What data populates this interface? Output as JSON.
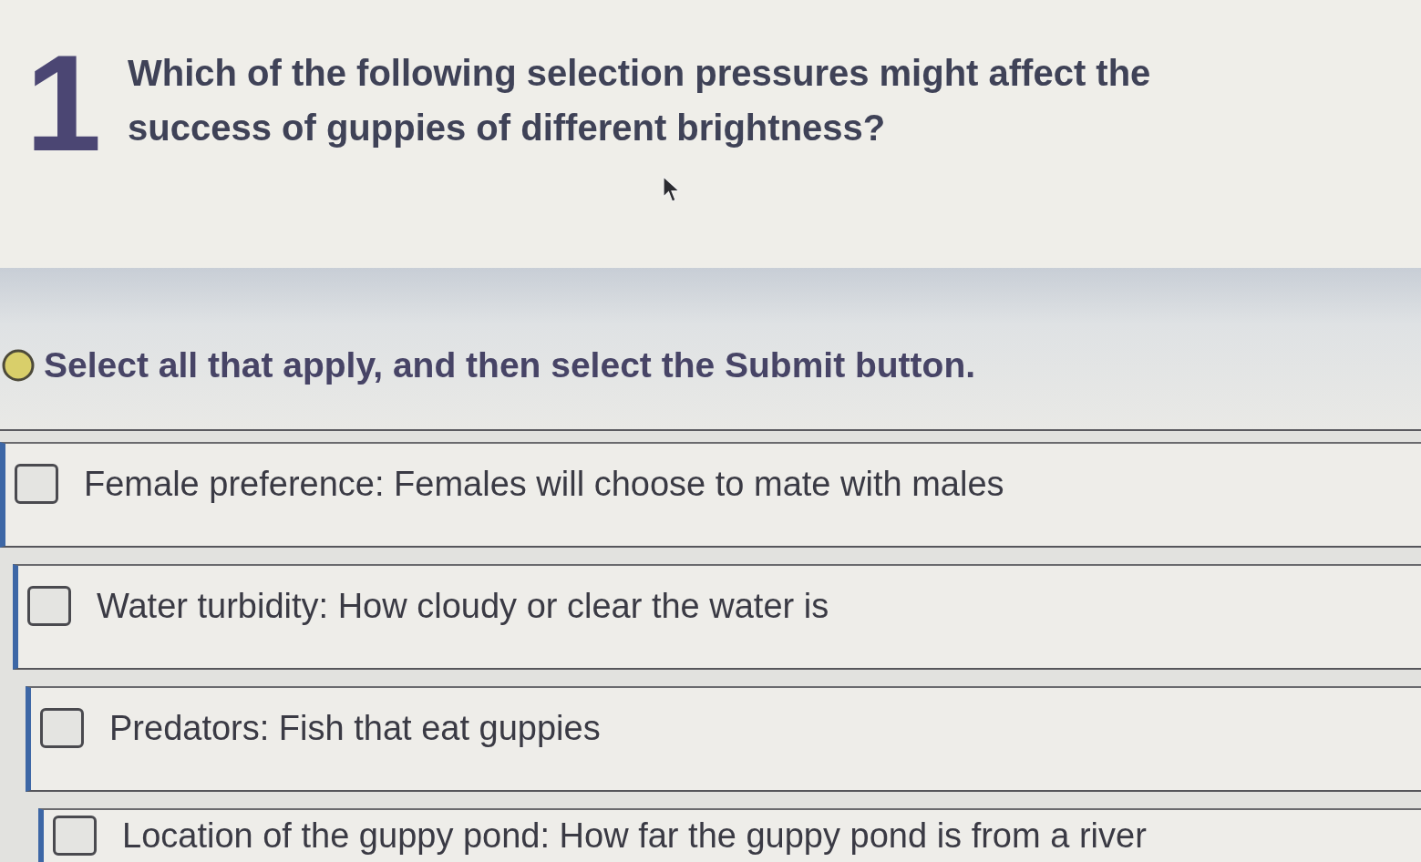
{
  "question": {
    "number": "1",
    "text": "Which of the following selection pressures might affect the success of guppies of different brightness?"
  },
  "instruction": {
    "text": "Select all that apply, and then select the Submit button."
  },
  "options": [
    {
      "label": "Female preference: Females will choose to mate with males",
      "checked": false
    },
    {
      "label": "Water turbidity: How cloudy or clear the water is",
      "checked": false
    },
    {
      "label": "Predators: Fish that eat guppies",
      "checked": false
    },
    {
      "label": "Location of the guppy pond: How far the guppy pond is from a river",
      "checked": false
    }
  ]
}
